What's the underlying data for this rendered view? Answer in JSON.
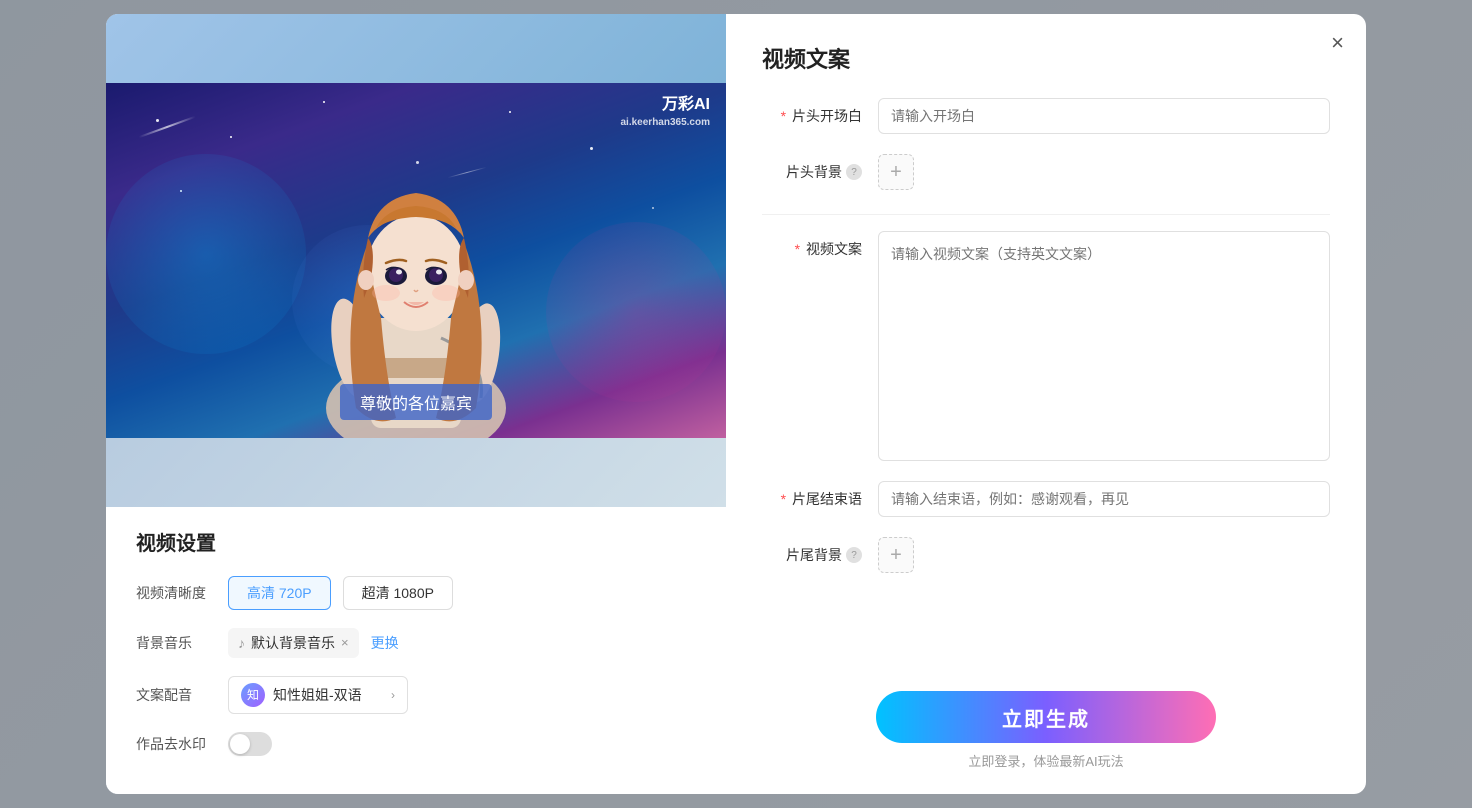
{
  "modal": {
    "close_label": "×",
    "left": {
      "watermark_brand": "万彩AI",
      "watermark_url": "ai.keerhan365.com",
      "subtitle_text": "尊敬的各位嘉宾",
      "settings_title": "视频设置",
      "quality_label": "视频清晰度",
      "quality_options": [
        {
          "label": "高清 720P",
          "active": true
        },
        {
          "label": "超清 1080P",
          "active": false
        }
      ],
      "music_label": "背景音乐",
      "music_name": "默认背景音乐",
      "music_change": "更换",
      "voice_label": "文案配音",
      "voice_name": "知性姐姐-双语",
      "watermark_label": "作品去水印"
    },
    "right": {
      "title": "视频文案",
      "fields": [
        {
          "label": "片头开场白",
          "required": true,
          "type": "input",
          "placeholder": "请输入开场白"
        },
        {
          "label": "片头背景",
          "required": false,
          "has_help": true,
          "type": "add"
        },
        {
          "label": "视频文案",
          "required": true,
          "type": "textarea",
          "placeholder": "请输入视频文案（支持英文文案）"
        },
        {
          "label": "片尾结束语",
          "required": true,
          "type": "input",
          "placeholder": "请输入结束语，例如：感谢观看，再见"
        },
        {
          "label": "片尾背景",
          "required": false,
          "has_help": true,
          "type": "add"
        }
      ],
      "generate_btn": "立即生成",
      "login_hint": "立即登录，体验最新AI玩法"
    }
  }
}
